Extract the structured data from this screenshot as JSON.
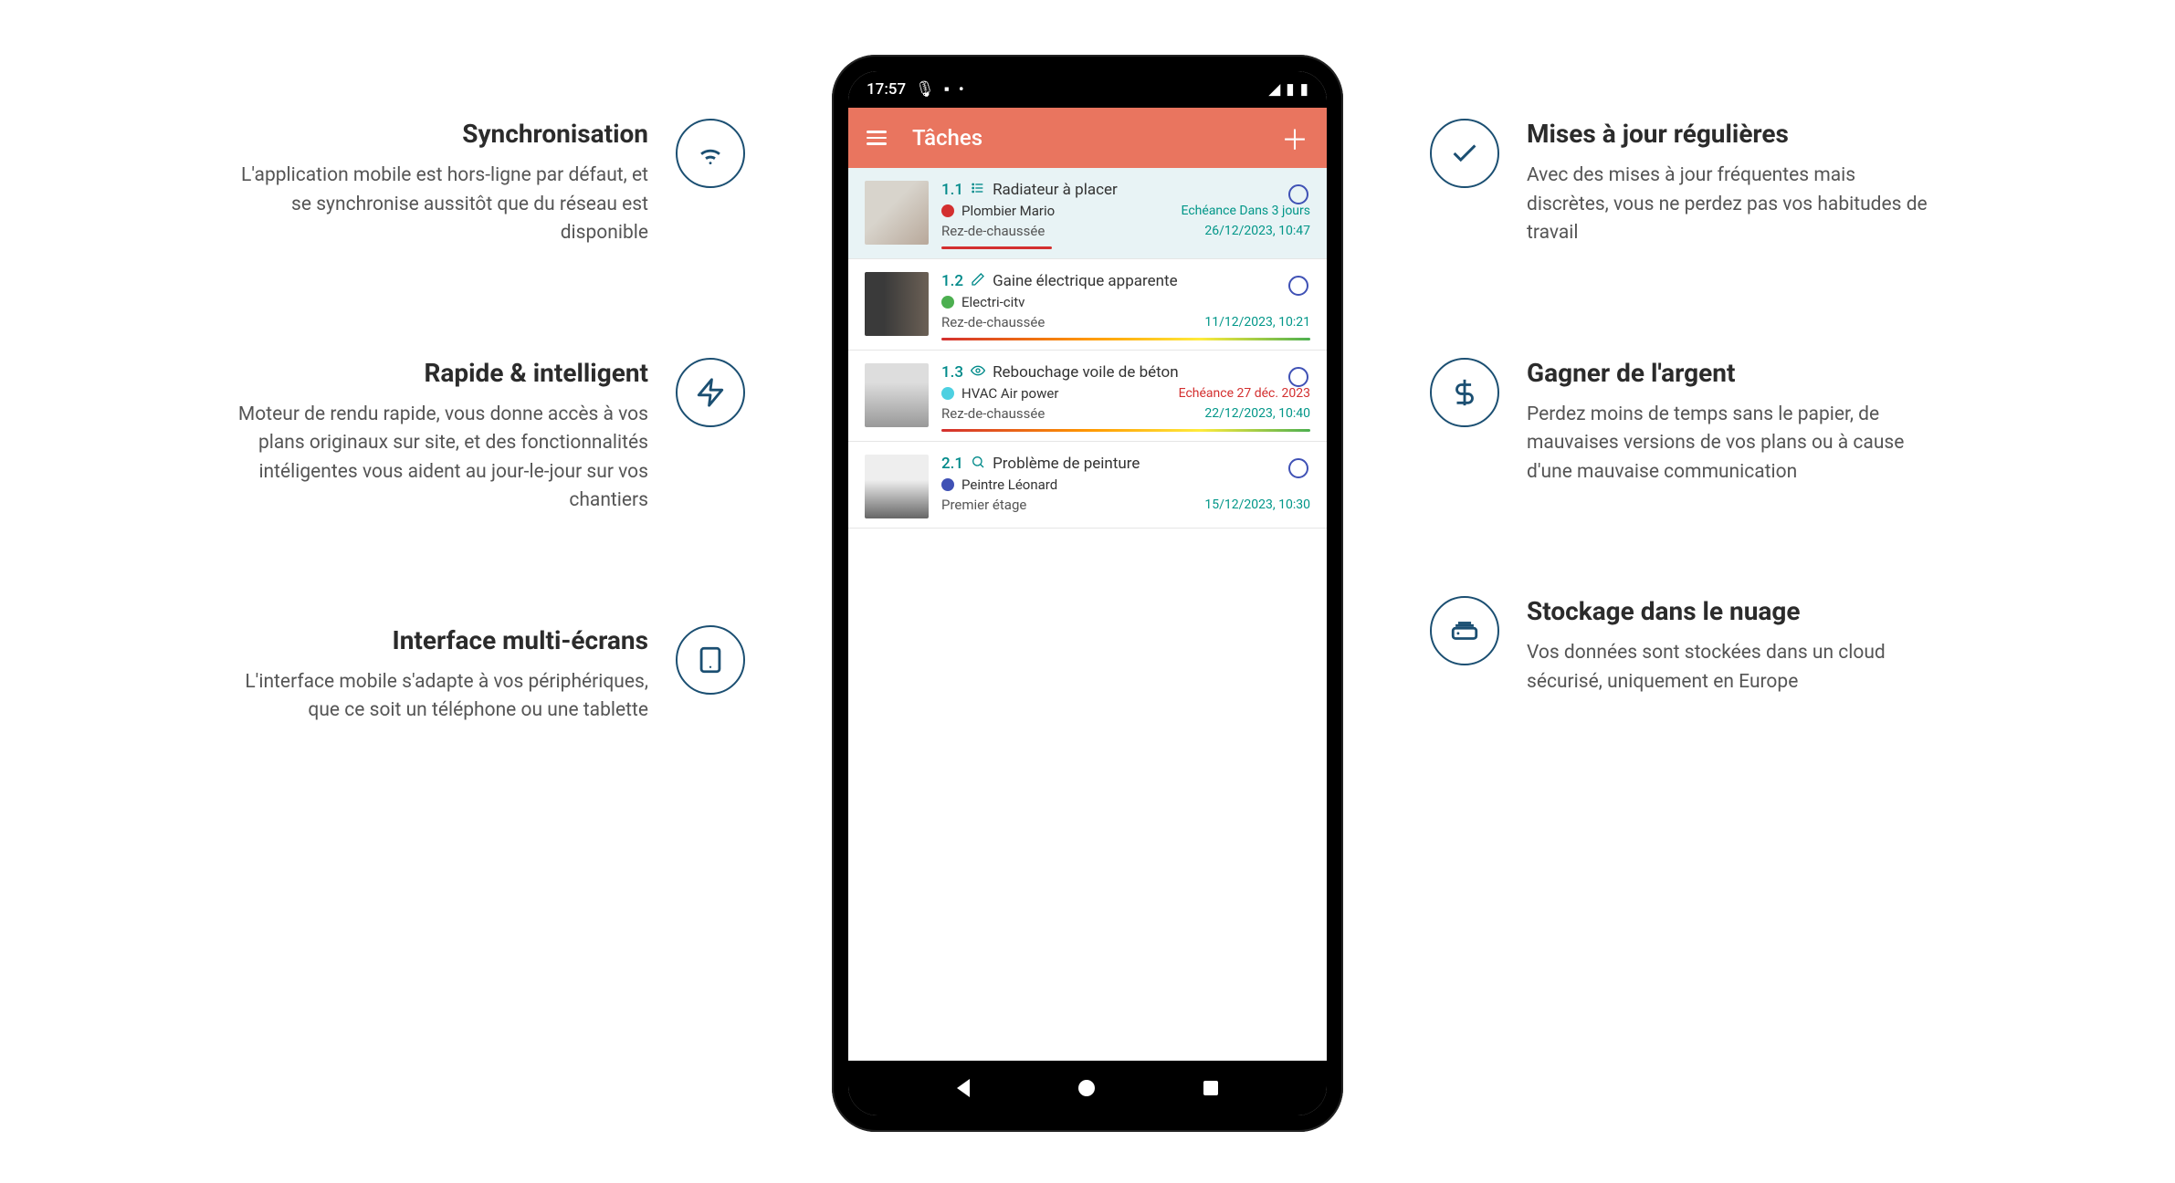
{
  "left": [
    {
      "title": "Synchronisation",
      "desc": "L'application mobile est hors-ligne par défaut, et se synchronise aussitôt que du réseau est disponible",
      "icon": "wifi-icon"
    },
    {
      "title": "Rapide & intelligent",
      "desc": "Moteur de rendu rapide, vous donne accès à vos plans originaux sur site, et des fonctionnalités intéligentes vous aident au jour-le-jour sur vos chantiers",
      "icon": "bolt-icon"
    },
    {
      "title": "Interface multi-écrans",
      "desc": "L'interface mobile s'adapte à vos périphériques, que ce soit un téléphone ou une tablette",
      "icon": "tablet-icon"
    }
  ],
  "right": [
    {
      "title": "Mises à jour régulières",
      "desc": "Avec des mises à jour fréquentes mais discrètes, vous ne perdez pas vos habitudes de travail",
      "icon": "check-icon"
    },
    {
      "title": "Gagner de l'argent",
      "desc": "Perdez moins de temps sans le papier, de mauvaises versions de vos plans ou à cause d'une mauvaise communication",
      "icon": "dollar-icon"
    },
    {
      "title": "Stockage dans le nuage",
      "desc": "Vos données sont stockées dans un cloud sécurisé, uniquement en Europe",
      "icon": "cloud-icon"
    }
  ],
  "phone": {
    "statusbar": {
      "time": "17:57"
    },
    "appbar": {
      "title": "Tâches"
    },
    "tasks": [
      {
        "num": "1.1",
        "title": "Radiateur à placer",
        "assignee": "Plombier Mario",
        "dotColor": "#d32f2f",
        "due": "Echéance Dans 3 jours",
        "dueClass": "due-teal",
        "location": "Rez-de-chaussée",
        "timestamp": "26/12/2023, 10:47",
        "selected": true,
        "icon": "list",
        "progress": "short"
      },
      {
        "num": "1.2",
        "title": "Gaine électrique apparente",
        "assignee": "Electri-citv",
        "dotColor": "#4caf50",
        "due": "",
        "location": "Rez-de-chaussée",
        "timestamp": "11/12/2023, 10:21",
        "icon": "pencil",
        "progress": "full"
      },
      {
        "num": "1.3",
        "title": "Rebouchage voile de béton",
        "assignee": "HVAC Air power",
        "dotColor": "#4dd0e1",
        "due": "Echéance 27 déc. 2023",
        "dueClass": "due",
        "location": "Rez-de-chaussée",
        "timestamp": "22/12/2023, 10:40",
        "icon": "eye",
        "progress": "full"
      },
      {
        "num": "2.1",
        "title": "Problème de peinture",
        "assignee": "Peintre Léonard",
        "dotColor": "#3f51b5",
        "due": "",
        "location": "Premier étage",
        "timestamp": "15/12/2023, 10:30",
        "icon": "search",
        "progress": "none"
      }
    ]
  }
}
